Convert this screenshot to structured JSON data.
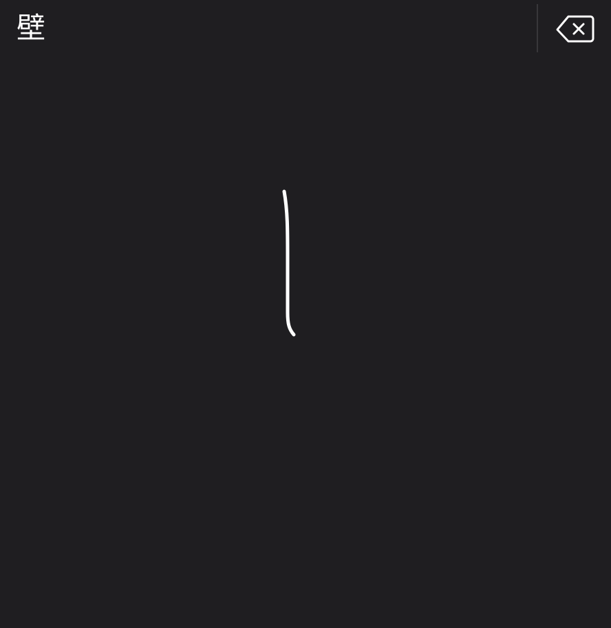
{
  "candidates": [
    "壁"
  ],
  "toolbar": {
    "delete_icon": "delete-left-icon"
  },
  "colors": {
    "background": "#1f1e21",
    "stroke": "#ffffff",
    "separator": "#38373a"
  }
}
